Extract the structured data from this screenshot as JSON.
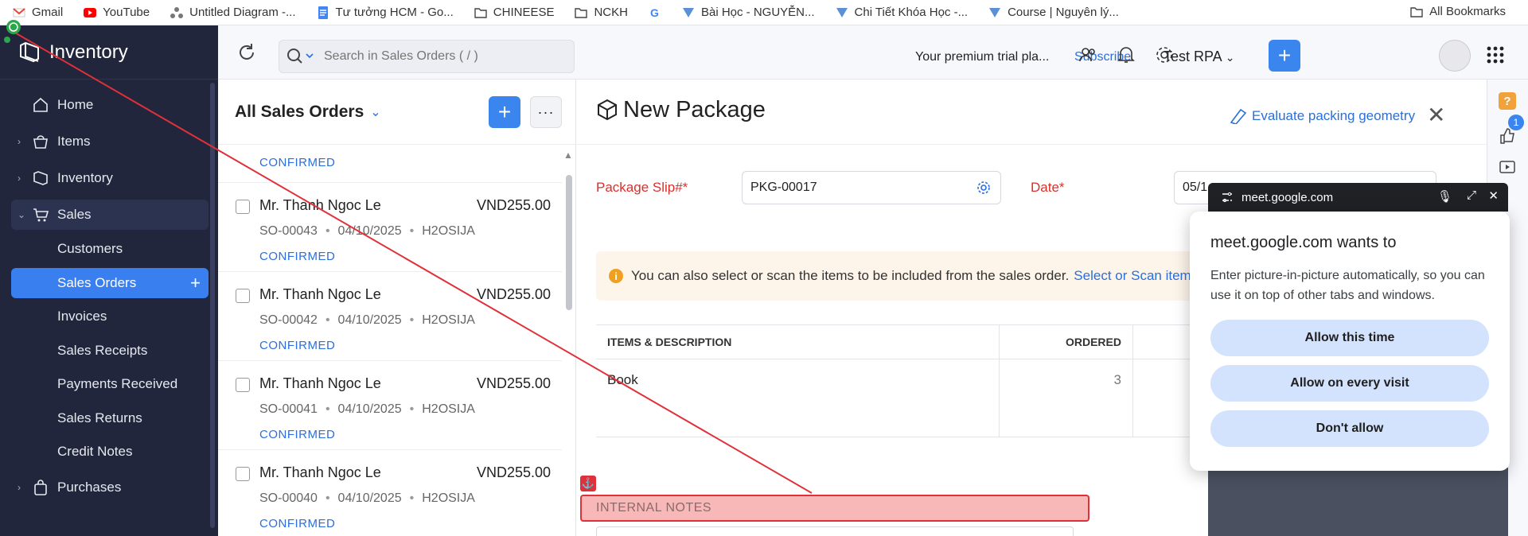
{
  "bookmarks": {
    "items": [
      {
        "label": "Gmail",
        "icon": "gmail-icon"
      },
      {
        "label": "YouTube",
        "icon": "youtube-icon"
      },
      {
        "label": "Untitled Diagram -...",
        "icon": "diagram-icon"
      },
      {
        "label": "Tư tưởng HCM - Go...",
        "icon": "docs-icon"
      },
      {
        "label": "CHINEESE",
        "icon": "folder-icon"
      },
      {
        "label": "NCKH",
        "icon": "folder-icon"
      },
      {
        "label": "",
        "icon": "google-icon"
      },
      {
        "label": "Bài Học - NGUYỄN...",
        "icon": "course-icon"
      },
      {
        "label": "Chi Tiết Khóa Học -...",
        "icon": "course-icon"
      },
      {
        "label": "Course | Nguyên lý...",
        "icon": "course-icon"
      }
    ],
    "all_label": "All Bookmarks"
  },
  "nav": {
    "brand": "Inventory",
    "items": [
      {
        "label": "Home",
        "icon": "home-icon"
      },
      {
        "label": "Items",
        "icon": "basket-icon"
      },
      {
        "label": "Inventory",
        "icon": "inventory-icon"
      },
      {
        "label": "Sales",
        "icon": "cart-icon"
      },
      {
        "label": "Customers"
      },
      {
        "label": "Sales Orders"
      },
      {
        "label": "Invoices"
      },
      {
        "label": "Sales Receipts"
      },
      {
        "label": "Payments Received"
      },
      {
        "label": "Sales Returns"
      },
      {
        "label": "Credit Notes"
      },
      {
        "label": "Purchases",
        "icon": "bag-icon"
      }
    ]
  },
  "header": {
    "search_placeholder": "Search in Sales Orders ( / )",
    "trial_text": "Your premium trial pla...",
    "subscribe": "Subscribe",
    "org_name": "Test RPA"
  },
  "list": {
    "title": "All Sales Orders",
    "top_status": "CONFIRMED",
    "orders": [
      {
        "customer": "Mr. Thanh Ngoc Le",
        "amount": "VND255.00",
        "number": "SO-00043",
        "date": "04/10/2025",
        "ref": "H2OSIJA",
        "status": "CONFIRMED"
      },
      {
        "customer": "Mr. Thanh Ngoc Le",
        "amount": "VND255.00",
        "number": "SO-00042",
        "date": "04/10/2025",
        "ref": "H2OSIJA",
        "status": "CONFIRMED"
      },
      {
        "customer": "Mr. Thanh Ngoc Le",
        "amount": "VND255.00",
        "number": "SO-00041",
        "date": "04/10/2025",
        "ref": "H2OSIJA",
        "status": "CONFIRMED"
      },
      {
        "customer": "Mr. Thanh Ngoc Le",
        "amount": "VND255.00",
        "number": "SO-00040",
        "date": "04/10/2025",
        "ref": "H2OSIJA",
        "status": "CONFIRMED"
      }
    ]
  },
  "form": {
    "title": "New Package",
    "evaluate": "Evaluate packing geometry",
    "slip_label": "Package Slip#*",
    "slip_value": "PKG-00017",
    "date_label": "Date*",
    "date_value": "05/1",
    "note_text": "You can also select or scan the items to be included from the sales order.",
    "note_link": "Select or Scan item",
    "table": {
      "headers": [
        "ITEMS & DESCRIPTION",
        "ORDERED"
      ],
      "rows": [
        {
          "item": "Book",
          "ordered": "3"
        }
      ]
    },
    "internal_notes": "INTERNAL NOTES"
  },
  "rail": {
    "badge": "1"
  },
  "popup": {
    "host": "meet.google.com",
    "title": "meet.google.com wants to",
    "description": "Enter picture-in-picture automatically, so you can use it on top of other tabs and windows.",
    "buttons": [
      "Allow this time",
      "Allow on every visit",
      "Don't allow"
    ]
  },
  "colors": {
    "nav_bg": "#21263c",
    "accent": "#3a86ee",
    "required": "#d9302c",
    "link": "#2a6fdb"
  }
}
